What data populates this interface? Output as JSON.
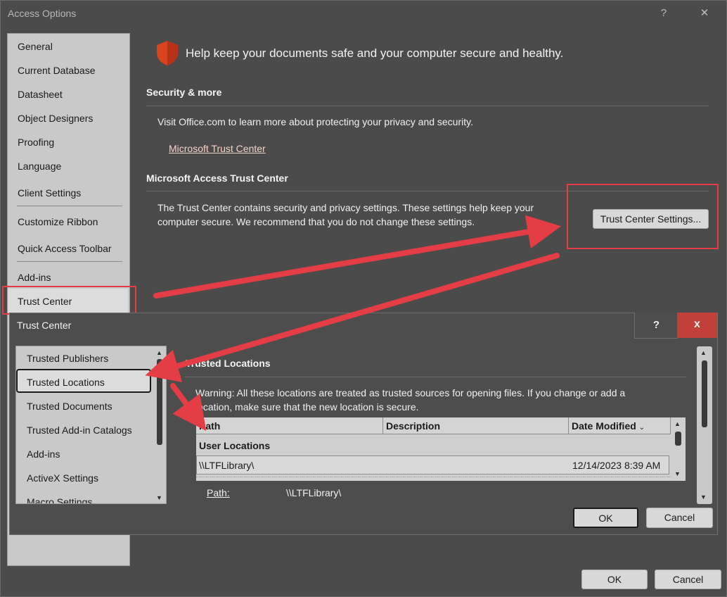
{
  "window": {
    "title": "Access Options",
    "help": "?",
    "close": "✕"
  },
  "nav": {
    "items": [
      "General",
      "Current Database",
      "Datasheet",
      "Object Designers",
      "Proofing",
      "Language",
      "Client Settings",
      "Customize Ribbon",
      "Quick Access Toolbar",
      "Add-ins",
      "Trust Center"
    ],
    "selected": "Trust Center"
  },
  "banner": {
    "text": "Help keep your documents safe and your computer secure and healthy."
  },
  "security": {
    "heading": "Security & more",
    "text": "Visit Office.com to learn more about protecting your privacy and security.",
    "link": "Microsoft Trust Center"
  },
  "trust_center_section": {
    "heading": "Microsoft Access Trust Center",
    "text_line1": "The Trust Center contains security and privacy settings. These settings help keep your",
    "text_line2": "computer secure. We recommend that you do not change these settings.",
    "button": "Trust Center Settings..."
  },
  "footer": {
    "ok": "OK",
    "cancel": "Cancel"
  },
  "tc_dialog": {
    "title": "Trust Center",
    "help": "?",
    "close": "x",
    "nav_items": [
      "Trusted Publishers",
      "Trusted Locations",
      "Trusted Documents",
      "Trusted Add-in Catalogs",
      "Add-ins",
      "ActiveX Settings",
      "Macro Settings"
    ],
    "selected": "Trusted Locations",
    "heading": "Trusted Locations",
    "warning_line1": "Warning: All these locations are treated as trusted sources for opening files.  If you change or add a",
    "warning_line2": "location, make sure that the new location is secure.",
    "columns": {
      "path": "Path",
      "description": "Description",
      "date_modified": "Date Modified"
    },
    "group": "User Locations",
    "rows": [
      {
        "path": "\\\\LTFLibrary\\",
        "description": "",
        "date": "12/14/2023 8:39 AM"
      }
    ],
    "detail_label": "Path:",
    "detail_value": "\\\\LTFLibrary\\",
    "ok": "OK",
    "cancel": "Cancel"
  },
  "colors": {
    "annotation_red": "#e43d45",
    "shield": "#d9431e"
  }
}
